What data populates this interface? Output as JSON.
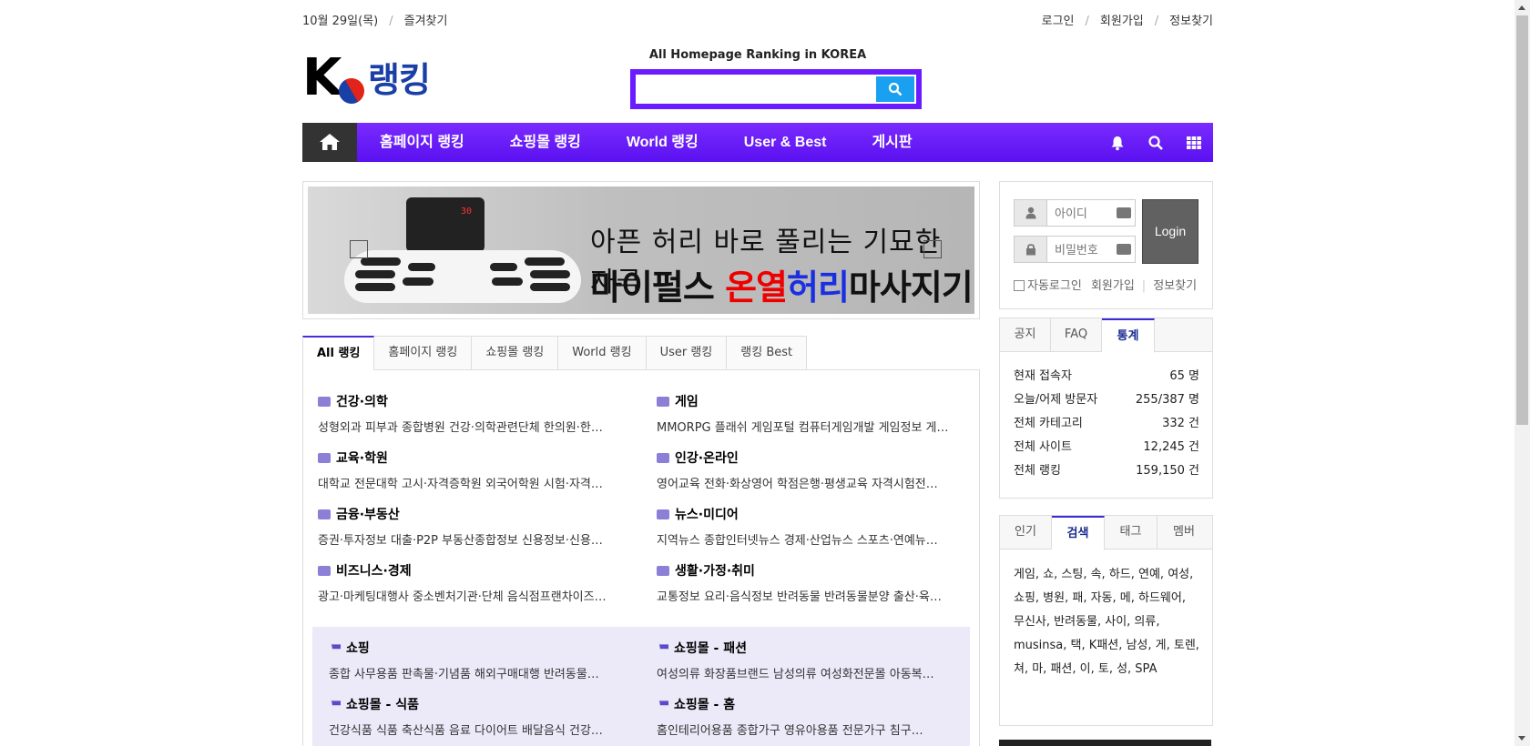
{
  "topbar": {
    "date": "10월 29일(목)",
    "favorites": "즐겨찾기",
    "login": "로그인",
    "signup": "회원가입",
    "find_info": "정보찾기"
  },
  "logo": {
    "letter": "K",
    "word": "랭킹"
  },
  "search": {
    "caption": "All Homepage Ranking in KOREA",
    "value": "",
    "placeholder": ""
  },
  "nav": {
    "items": [
      "홈페이지 랭킹",
      "쇼핑몰 랭킹",
      "World 랭킹",
      "User & Best",
      "게시판"
    ]
  },
  "banner": {
    "line1": "아픈 허리 바로 풀리는 기묘한 자극",
    "line2_a": "마이펄스 ",
    "line2_red": "온열",
    "line2_blue": "허리",
    "line2_b": "마사지기",
    "device_display": "30"
  },
  "ranking_tabs": [
    "All 랭킹",
    "홈페이지 랭킹",
    "쇼핑몰 랭킹",
    "World 랭킹",
    "User 랭킹",
    "랭킹 Best"
  ],
  "categories": [
    {
      "title": "건강·의학",
      "desc": "성형외과 피부과 종합병원 건강·의학관련단체 한의원·한…"
    },
    {
      "title": "게임",
      "desc": "MMORPG 플래쉬 게임포털 컴퓨터게임개발 게임정보 게…"
    },
    {
      "title": "교육·학원",
      "desc": "대학교 전문대학 고시·자격증학원 외국어학원 시험·자격…"
    },
    {
      "title": "인강·온라인",
      "desc": "영어교육 전화·화상영어 학점은행·평생교육 자격시험전…"
    },
    {
      "title": "금융·부동산",
      "desc": "증권·투자정보 대출·P2P 부동산종합정보 신용정보·신용…"
    },
    {
      "title": "뉴스·미디어",
      "desc": "지역뉴스 종합인터넷뉴스 경제·산업뉴스 스포츠·연예뉴…"
    },
    {
      "title": "비즈니스·경제",
      "desc": "광고·마케팅대행사 중소벤처기관·단체 음식점프랜차이즈…"
    },
    {
      "title": "생활·가정·취미",
      "desc": "교통정보 요리·음식정보 반려동물 반려동물분양 출산·육…"
    }
  ],
  "shop_categories": [
    {
      "title": "쇼핑",
      "desc": "종합 사무용품 판촉물·기념품 해외구매대행 반려동물…"
    },
    {
      "title": "쇼핑몰 - 패션",
      "desc": "여성의류 화장품브랜드 남성의류 여성화전문몰 아동복…"
    },
    {
      "title": "쇼핑몰 - 식품",
      "desc": "건강식품 식품 축산식품 음료 다이어트 배달음식 건강…"
    },
    {
      "title": "쇼핑몰 - 홈",
      "desc": "홈인테리어용품 종합가구 영유아용품 전문가구 침구…"
    }
  ],
  "login": {
    "id_placeholder": "아이디",
    "pw_placeholder": "비밀번호",
    "button": "Login",
    "auto_login": "자동로그인",
    "signup": "회원가입",
    "find_info": "정보찾기"
  },
  "stats_tabs": [
    "공지",
    "FAQ",
    "통계"
  ],
  "stats": [
    {
      "label": "현재 접속자",
      "value": "65 명"
    },
    {
      "label": "오늘/어제 방문자",
      "value": "255/387 명"
    },
    {
      "label": "전체 카테고리",
      "value": "332 건"
    },
    {
      "label": "전체 사이트",
      "value": "12,245 건"
    },
    {
      "label": "전체 랭킹",
      "value": "159,150 건"
    }
  ],
  "keyword_tabs": [
    "인기",
    "검색",
    "태그",
    "멤버"
  ],
  "keywords": "게임, 쇼, 스팅, 속, 하드, 연예, 여성, 쇼핑, 병원, 패, 자동, 메, 하드웨어, 무신사, 반려동물, 사이, 의류, musinsa, 택, K패션, 남성, 게, 토렌, 쳐, 마, 패션, 이, 토, 성, SPA",
  "colors": {
    "accent": "#6a1bff",
    "search_button": "#1aa0f0"
  }
}
